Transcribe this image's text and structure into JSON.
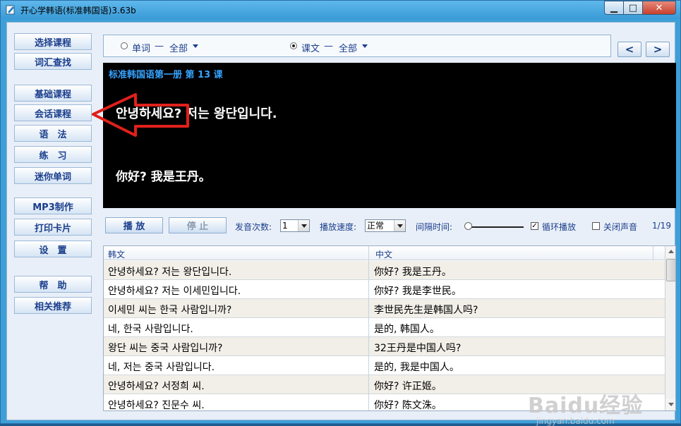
{
  "window": {
    "title": "开心学韩语(标准韩国语)3.63b",
    "controls": {
      "minimize": "▁",
      "maximize": "□",
      "close": "✕"
    }
  },
  "sidebar": {
    "items": [
      {
        "label": "选择课程"
      },
      {
        "label": "词汇查找"
      },
      {
        "label": "基础课程"
      },
      {
        "label": "会话课程"
      },
      {
        "label": "语　法"
      },
      {
        "label": "练　习"
      },
      {
        "label": "迷你单词"
      },
      {
        "label": "MP3制作"
      },
      {
        "label": "打印卡片"
      },
      {
        "label": "设　置"
      },
      {
        "label": "帮　助"
      },
      {
        "label": "相关推荐"
      }
    ]
  },
  "mode": {
    "word": {
      "label": "单词",
      "dash": "—",
      "scope": "全部",
      "selected": false
    },
    "text": {
      "label": "课文",
      "dash": "—",
      "scope": "全部",
      "selected": true
    },
    "prev": "<",
    "next": ">"
  },
  "display": {
    "lesson_title": "标准韩国语第一册 第 13 课",
    "korean": "안녕하세요? 저는 왕단입니다.",
    "chinese": "你好? 我是王丹。"
  },
  "controls": {
    "play": "播 放",
    "stop": "停 止",
    "repeat_label": "发音次数:",
    "repeat_value": "1",
    "speed_label": "播放速度:",
    "speed_value": "正常",
    "interval_label": "间隔时间:",
    "interval_level": 0,
    "loop_label": "循环播放",
    "loop_checked": true,
    "mute_label": "关闭声音",
    "mute_checked": false,
    "page_counter": "1/19",
    "check_mark": "✓"
  },
  "table": {
    "columns": [
      "韩文",
      "中文"
    ],
    "rows": [
      [
        "안녕하세요? 저는 왕단입니다.",
        "你好? 我是王丹。"
      ],
      [
        "안녕하세요? 저는 이세민입니다.",
        "你好? 我是李世民。"
      ],
      [
        "이세민 씨는 한국 사람입니까?",
        "李世民先生是韩国人吗?"
      ],
      [
        "네, 한국 사람입니다.",
        "是的, 韩国人。"
      ],
      [
        "왕단 씨는 중국 사람입니까?",
        "32王丹是中国人吗?"
      ],
      [
        "네, 저는 중국 사람입니다.",
        "是的, 我是中国人。"
      ],
      [
        "안녕하세요? 서정희 씨.",
        "你好? 许正姬。"
      ],
      [
        "안녕하세요? 진문수 씨.",
        "你好? 陈文洙。"
      ]
    ]
  },
  "watermark": {
    "logo": "Baidu经验",
    "url": "jingyan.baidu.com"
  },
  "colors": {
    "accent": "#1a3e8c",
    "title_blue": "#36a4ff",
    "frame": "#3e9fd8",
    "arrow": "#e0201b"
  }
}
